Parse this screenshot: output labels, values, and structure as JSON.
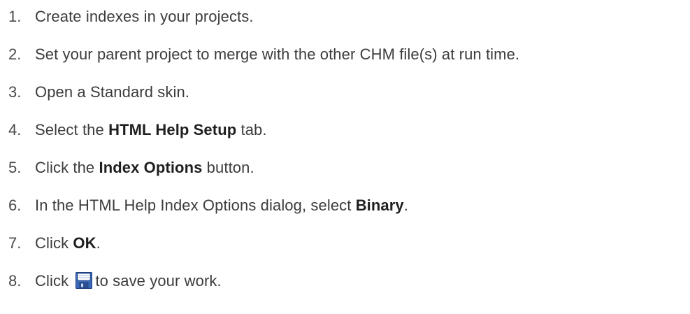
{
  "steps": [
    {
      "number": "1.",
      "segments": [
        {
          "text": "Create indexes in your projects.",
          "bold": false
        }
      ]
    },
    {
      "number": "2.",
      "segments": [
        {
          "text": "Set your parent project to merge with the other CHM file(s) at run time.",
          "bold": false
        }
      ]
    },
    {
      "number": "3.",
      "segments": [
        {
          "text": "Open a Standard skin.",
          "bold": false
        }
      ]
    },
    {
      "number": "4.",
      "segments": [
        {
          "text": "Select the ",
          "bold": false
        },
        {
          "text": "HTML Help Setup",
          "bold": true
        },
        {
          "text": " tab.",
          "bold": false
        }
      ]
    },
    {
      "number": "5.",
      "segments": [
        {
          "text": "Click the ",
          "bold": false
        },
        {
          "text": "Index Options",
          "bold": true
        },
        {
          "text": " button.",
          "bold": false
        }
      ]
    },
    {
      "number": "6.",
      "segments": [
        {
          "text": "In the HTML Help Index Options dialog, select ",
          "bold": false
        },
        {
          "text": "Binary",
          "bold": true
        },
        {
          "text": ".",
          "bold": false
        }
      ]
    },
    {
      "number": "7.",
      "segments": [
        {
          "text": "Click ",
          "bold": false
        },
        {
          "text": "OK",
          "bold": true
        },
        {
          "text": ".",
          "bold": false
        }
      ]
    },
    {
      "number": "8.",
      "segments": [
        {
          "text": "Click ",
          "bold": false
        },
        {
          "icon": "save-icon"
        },
        {
          "text": "to save your work.",
          "bold": false
        }
      ]
    }
  ],
  "colors": {
    "text": "#3c3c3c",
    "bold_text": "#1f1f1f",
    "icon_blue": "#3a68b8",
    "icon_border": "#1f3f7a"
  }
}
